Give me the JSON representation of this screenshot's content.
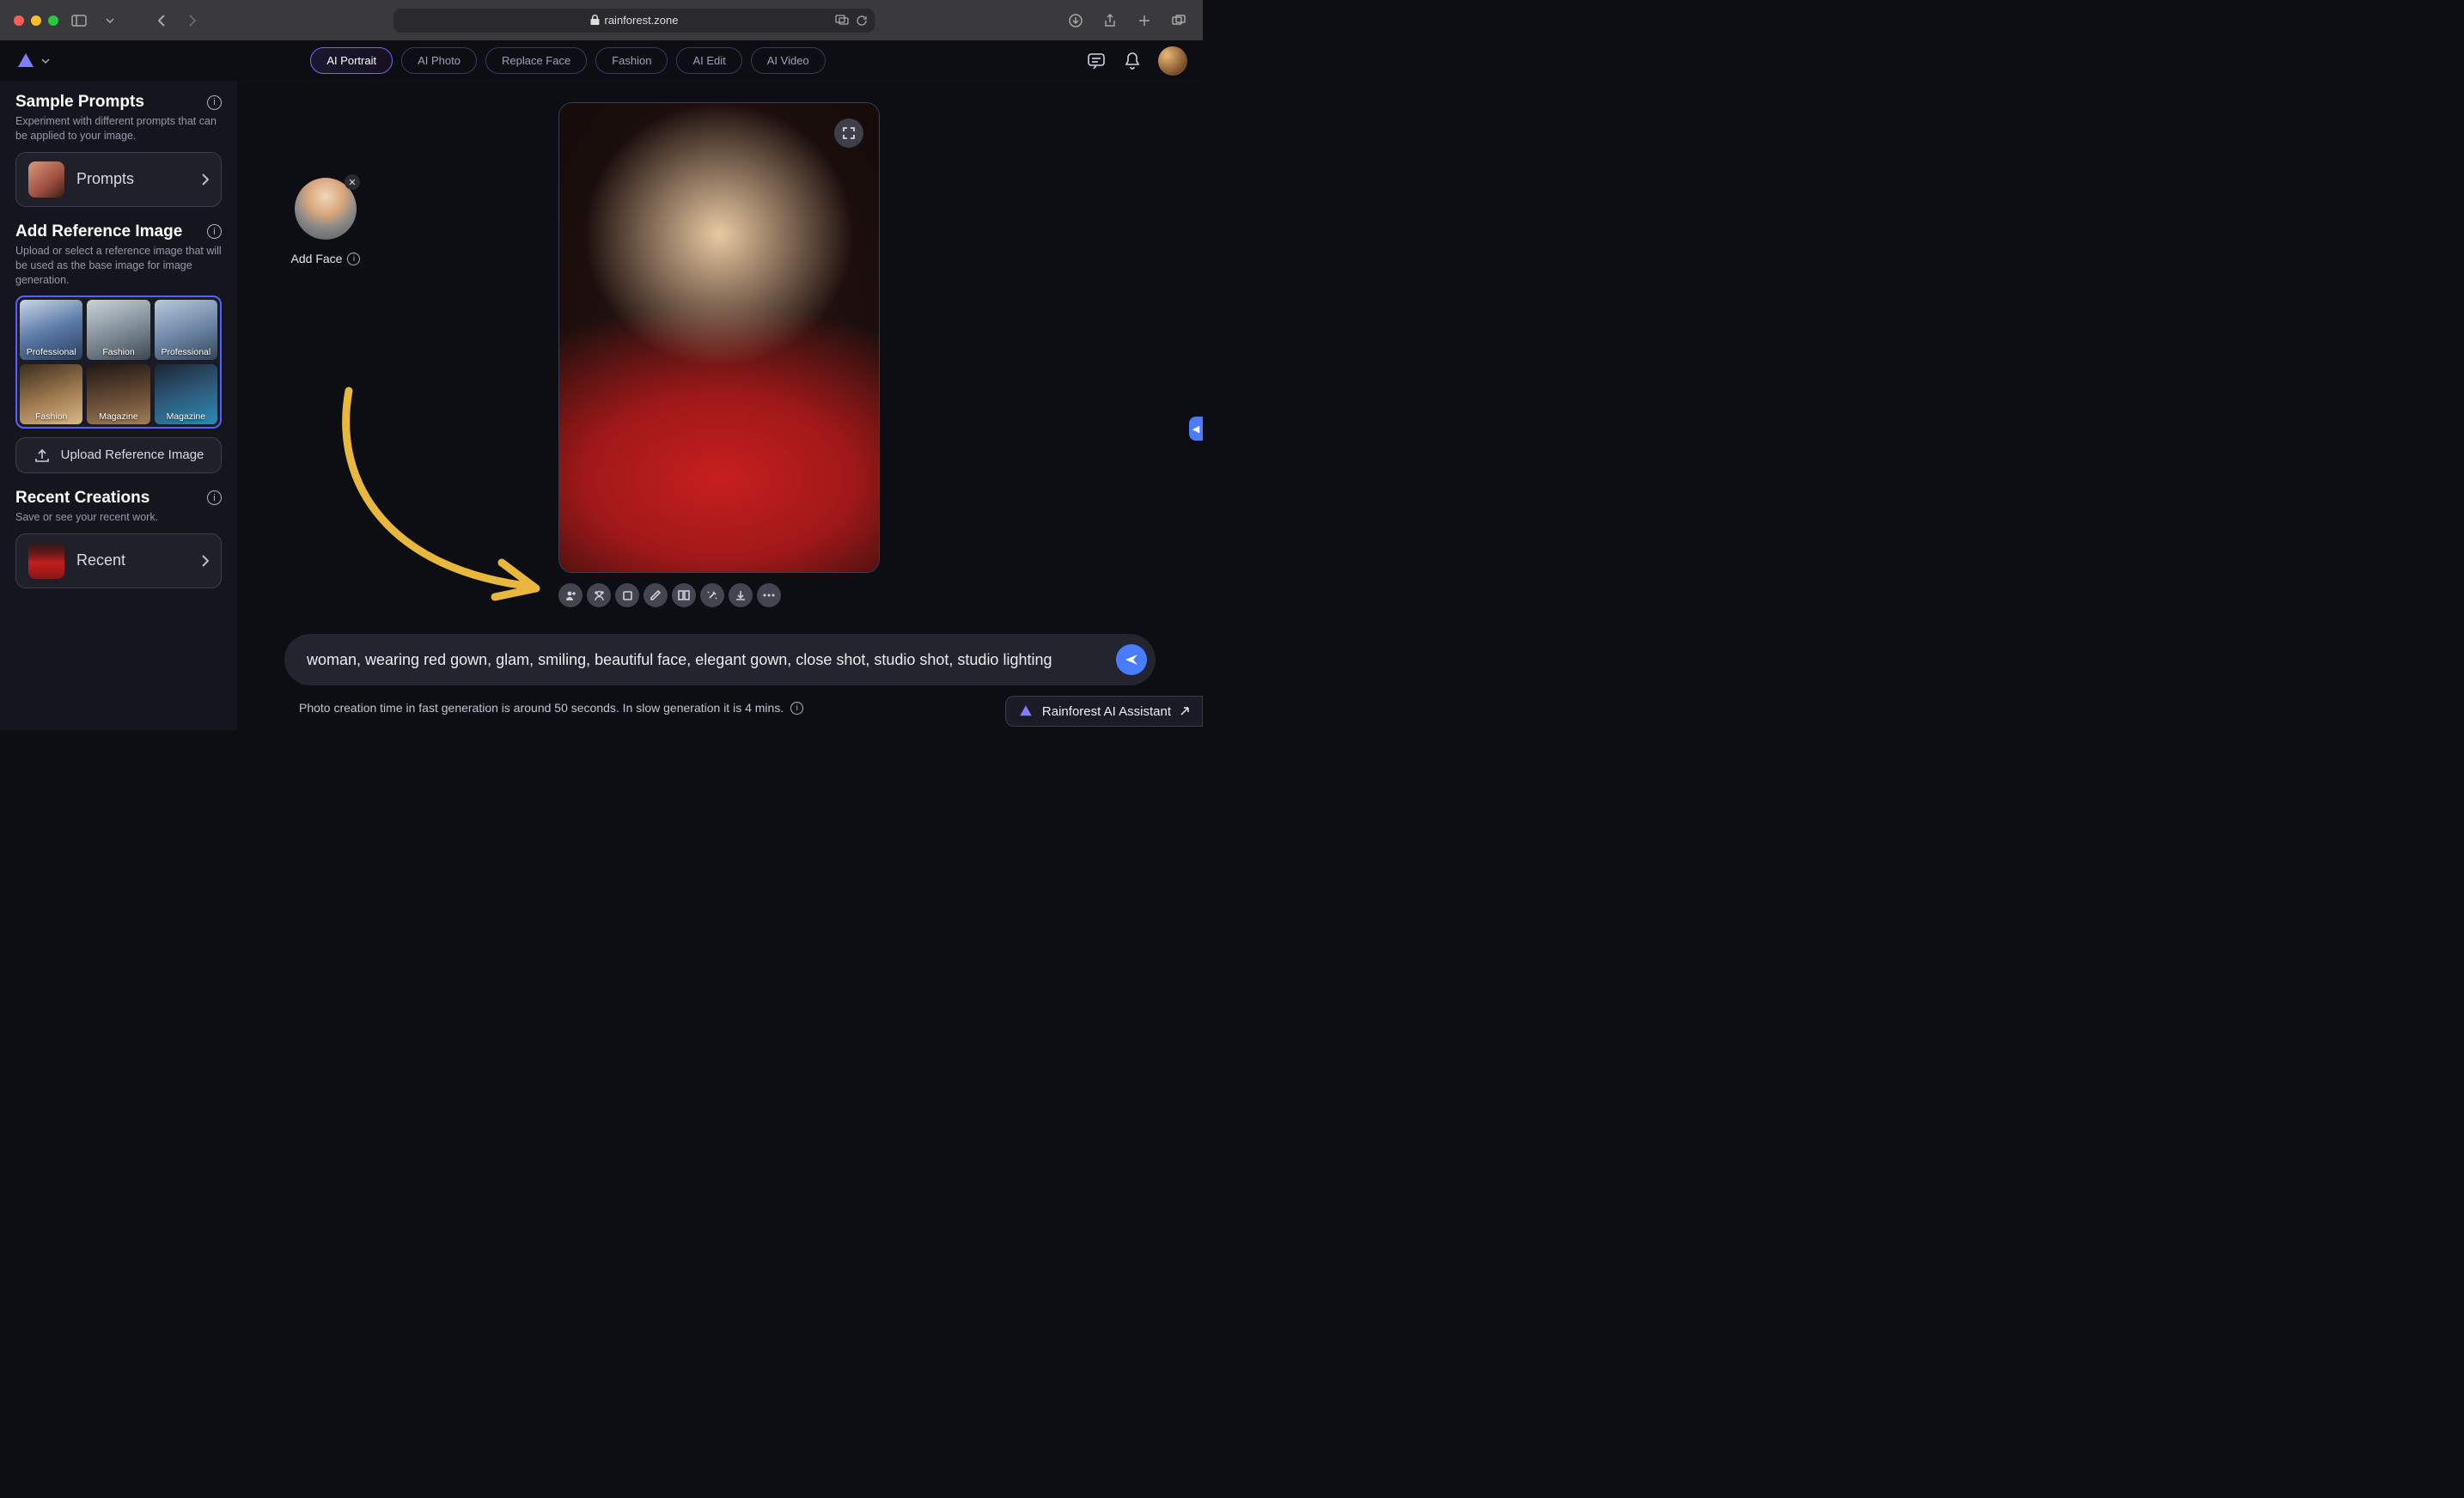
{
  "browser": {
    "url_host": "rainforest.zone"
  },
  "topnav": {
    "tabs": [
      {
        "label": "AI Portrait",
        "active": true
      },
      {
        "label": "AI Photo",
        "active": false
      },
      {
        "label": "Replace Face",
        "active": false
      },
      {
        "label": "Fashion",
        "active": false
      },
      {
        "label": "AI Edit",
        "active": false
      },
      {
        "label": "AI Video",
        "active": false
      }
    ]
  },
  "sidebar": {
    "sample": {
      "title": "Sample Prompts",
      "sub": "Experiment with different prompts that can be applied to your image.",
      "button": "Prompts"
    },
    "reference": {
      "title": "Add Reference Image",
      "sub": "Upload or select a reference image that will be used as the base image for image generation.",
      "items": [
        {
          "label": "Professional"
        },
        {
          "label": "Fashion"
        },
        {
          "label": "Professional"
        },
        {
          "label": "Fashion"
        },
        {
          "label": "Magazine"
        },
        {
          "label": "Magazine"
        }
      ],
      "upload": "Upload Reference Image"
    },
    "recent": {
      "title": "Recent Creations",
      "sub": "Save or see your recent work.",
      "button": "Recent"
    }
  },
  "content": {
    "add_face": "Add Face",
    "action_icons": [
      "add-person-icon",
      "replace-face-icon",
      "crop-icon",
      "edit-icon",
      "compare-icon",
      "magic-icon",
      "download-icon",
      "more-icon"
    ]
  },
  "prompt": {
    "text": "woman, wearing red gown, glam, smiling, beautiful face,  elegant gown,  close shot, studio shot, studio lighting"
  },
  "gen_info": "Photo creation time in fast generation is around 50 seconds. In slow generation it is 4 mins.",
  "assistant": "Rainforest AI Assistant"
}
